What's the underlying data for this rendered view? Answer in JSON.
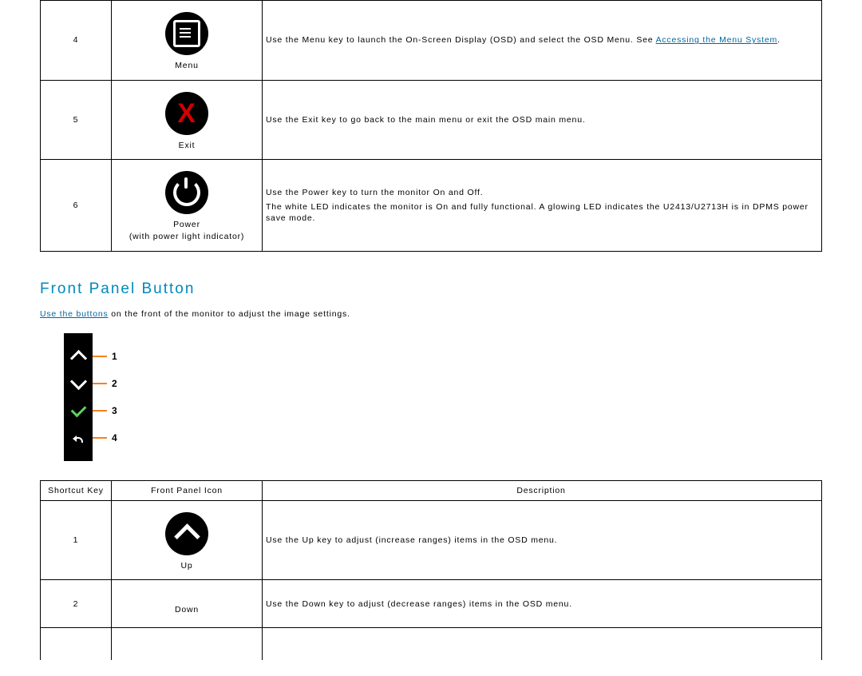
{
  "table1": {
    "rows": [
      {
        "num": "4",
        "icon_label": "Menu",
        "desc_prefix": "Use the Menu key to launch the On-Screen Display (OSD) and select the OSD Menu. See ",
        "desc_link": "Accessing the Menu System",
        "desc_suffix": "."
      },
      {
        "num": "5",
        "icon_label": "Exit",
        "desc": "Use the Exit key to go back to the main menu or exit the OSD main menu."
      },
      {
        "num": "6",
        "icon_label": "Power",
        "icon_sub": "(with power light indicator)",
        "desc_a": "Use the Power key to turn the monitor On and Off.",
        "desc_b": "The white LED indicates the monitor is On and fully functional. A glowing LED indicates the U2413/U2713H is in DPMS power save mode."
      }
    ]
  },
  "section_title": "Front Panel Button",
  "intro": {
    "link": "Use the buttons",
    "rest": " on the front of the monitor to adjust the image settings."
  },
  "panel_numbers": [
    "1",
    "2",
    "3",
    "4"
  ],
  "table2": {
    "headers": [
      "Shortcut Key",
      "Front Panel Icon",
      "Description"
    ],
    "rows": [
      {
        "num": "1",
        "icon_label": "Up",
        "desc": "Use the Up key to adjust (increase ranges) items in the OSD menu."
      },
      {
        "num": "2",
        "icon_label": "Down",
        "desc": "Use the Down key to adjust (decrease ranges) items in the OSD menu."
      }
    ]
  }
}
